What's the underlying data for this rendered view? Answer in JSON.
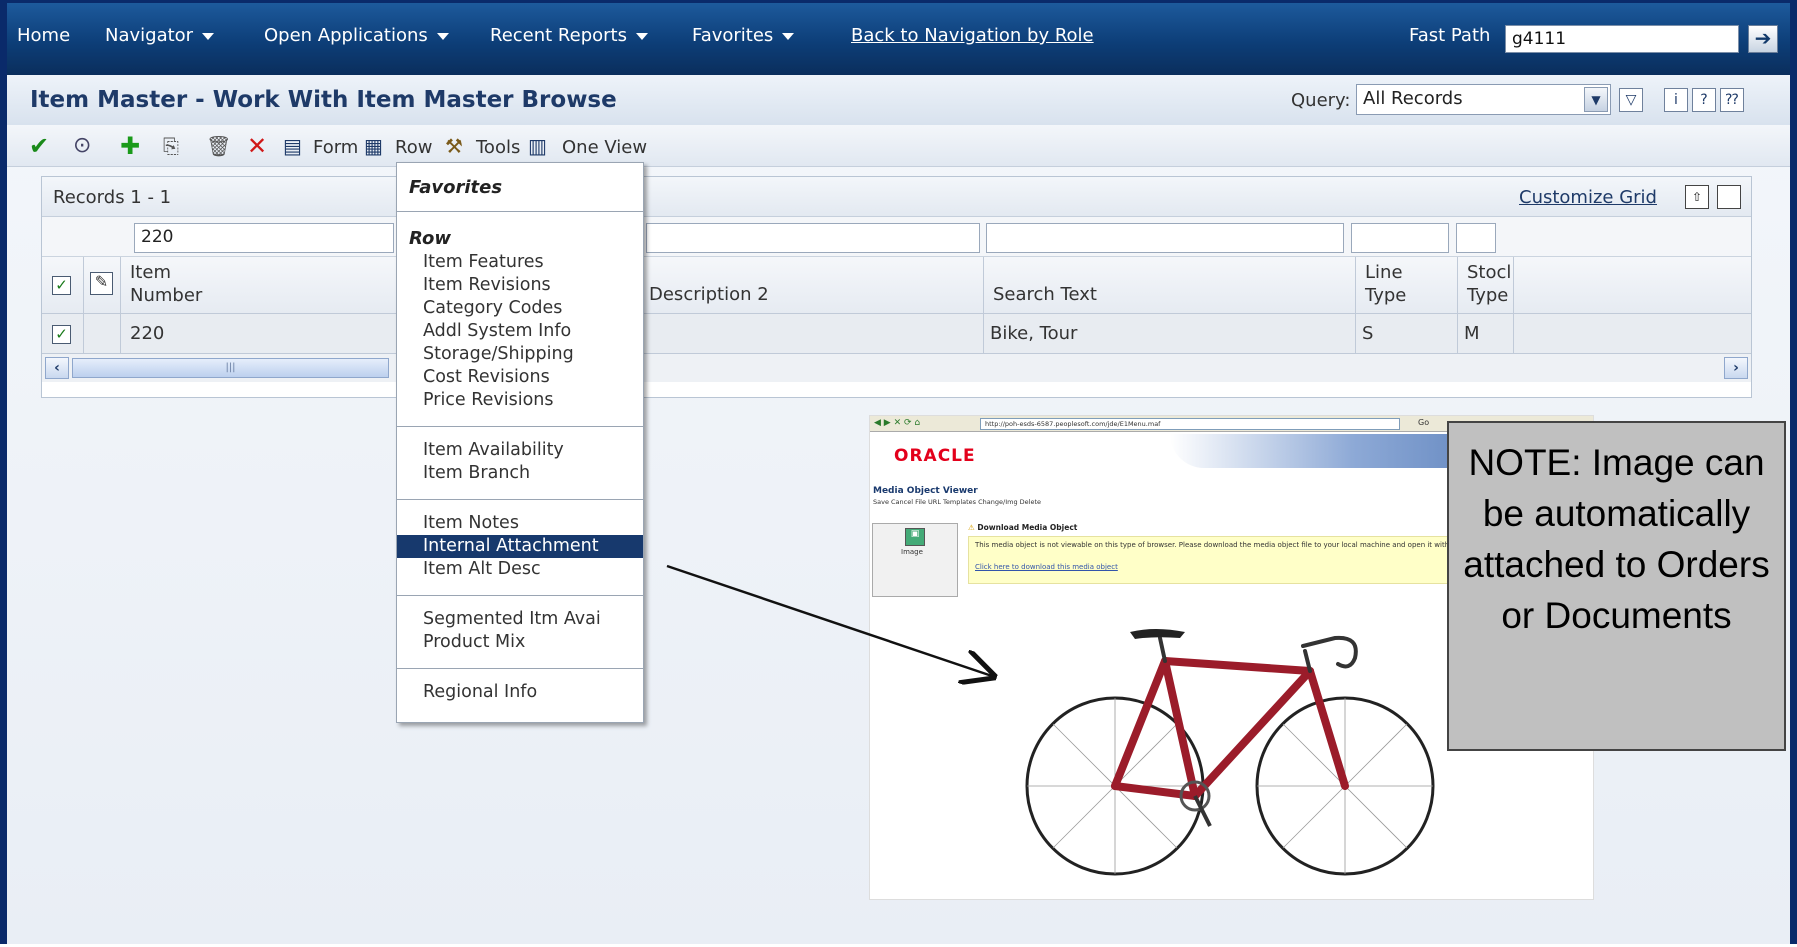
{
  "topnav": {
    "home": "Home",
    "navigator": "Navigator",
    "open_applications": "Open Applications",
    "recent_reports": "Recent Reports",
    "favorites": "Favorites",
    "back_link": "Back to Navigation by Role",
    "fast_path_label": "Fast Path",
    "fast_path_value": "g4111"
  },
  "title": "Item Master - Work With Item Master Browse",
  "query": {
    "label": "Query:",
    "value": "All Records"
  },
  "toolbar": {
    "form": "Form",
    "row": "Row",
    "tools": "Tools",
    "one_view": "One View"
  },
  "grid": {
    "records": "Records 1 - 1",
    "customize": "Customize Grid",
    "filter_item_number": "220",
    "columns": {
      "item_number": "Item\nNumber",
      "description2": "Description 2",
      "search_text": "Search Text",
      "line_type": "Line\nType",
      "stock_type": "Stocl\nType"
    },
    "row": {
      "item_number": "220",
      "search_text": "Bike, Tour",
      "line_type": "S",
      "stock_type": "M"
    }
  },
  "menu": {
    "favorites_heading": "Favorites",
    "row_heading": "Row",
    "items": [
      "Item Features",
      "Item Revisions",
      "Category Codes",
      "Addl System Info",
      "Storage/Shipping",
      "Cost Revisions",
      "Price Revisions",
      "Item Availability",
      "Item Branch",
      "Item Notes",
      "Internal Attachment",
      "Item Alt Desc",
      "Segmented Itm Avai",
      "Product Mix",
      "Regional Info"
    ],
    "selected": "Internal Attachment"
  },
  "screenshot": {
    "url": "http://poh-esds-6587.peoplesoft.com/jde/E1Menu.maf",
    "logo": "ORACLE",
    "viewer_title": "Media Object Viewer",
    "toolbar_text": "Save   Cancel  File    URL    Templates  Change/Img  Delete",
    "thumb_label": "Image",
    "download_heading": "Download Media Object",
    "download_note": "This media object is not viewable on this type of browser. Please download the media object file to your local machine and open it with the appropriate application.",
    "download_link": "Click here to download this media object",
    "go": "Go"
  },
  "note": "NOTE: Image can be automatically attached to Orders or Documents",
  "colors": {
    "nav": "#0d3e78",
    "selected": "#17396d",
    "title": "#1e3a68",
    "note_bg": "#c0c0c0"
  }
}
